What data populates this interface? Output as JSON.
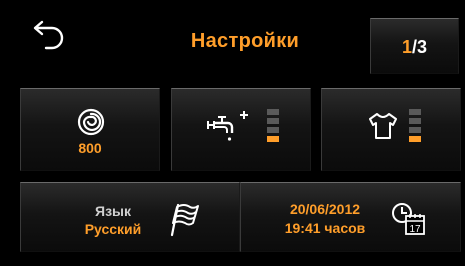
{
  "header": {
    "title": "Настройки",
    "back_icon": "back-arrow-icon",
    "page_current": "1",
    "page_separator": "/",
    "page_total": "3"
  },
  "tiles": {
    "spin": {
      "icon": "spin-speed-icon",
      "value": "800"
    },
    "water": {
      "icon": "faucet-plus-icon",
      "level": 1,
      "level_max": 3
    },
    "dry": {
      "icon": "tshirt-icon",
      "level": 1,
      "level_max": 3
    },
    "language": {
      "label": "Язык",
      "value": "Русский",
      "icon": "flag-icon"
    },
    "datetime": {
      "date": "20/06/2012",
      "time": "19:41 часов",
      "icon": "clock-calendar-icon",
      "calendar_day": "17"
    }
  },
  "colors": {
    "accent": "#ff9e2a",
    "background": "#000000",
    "level_off": "#5a5a5a"
  }
}
